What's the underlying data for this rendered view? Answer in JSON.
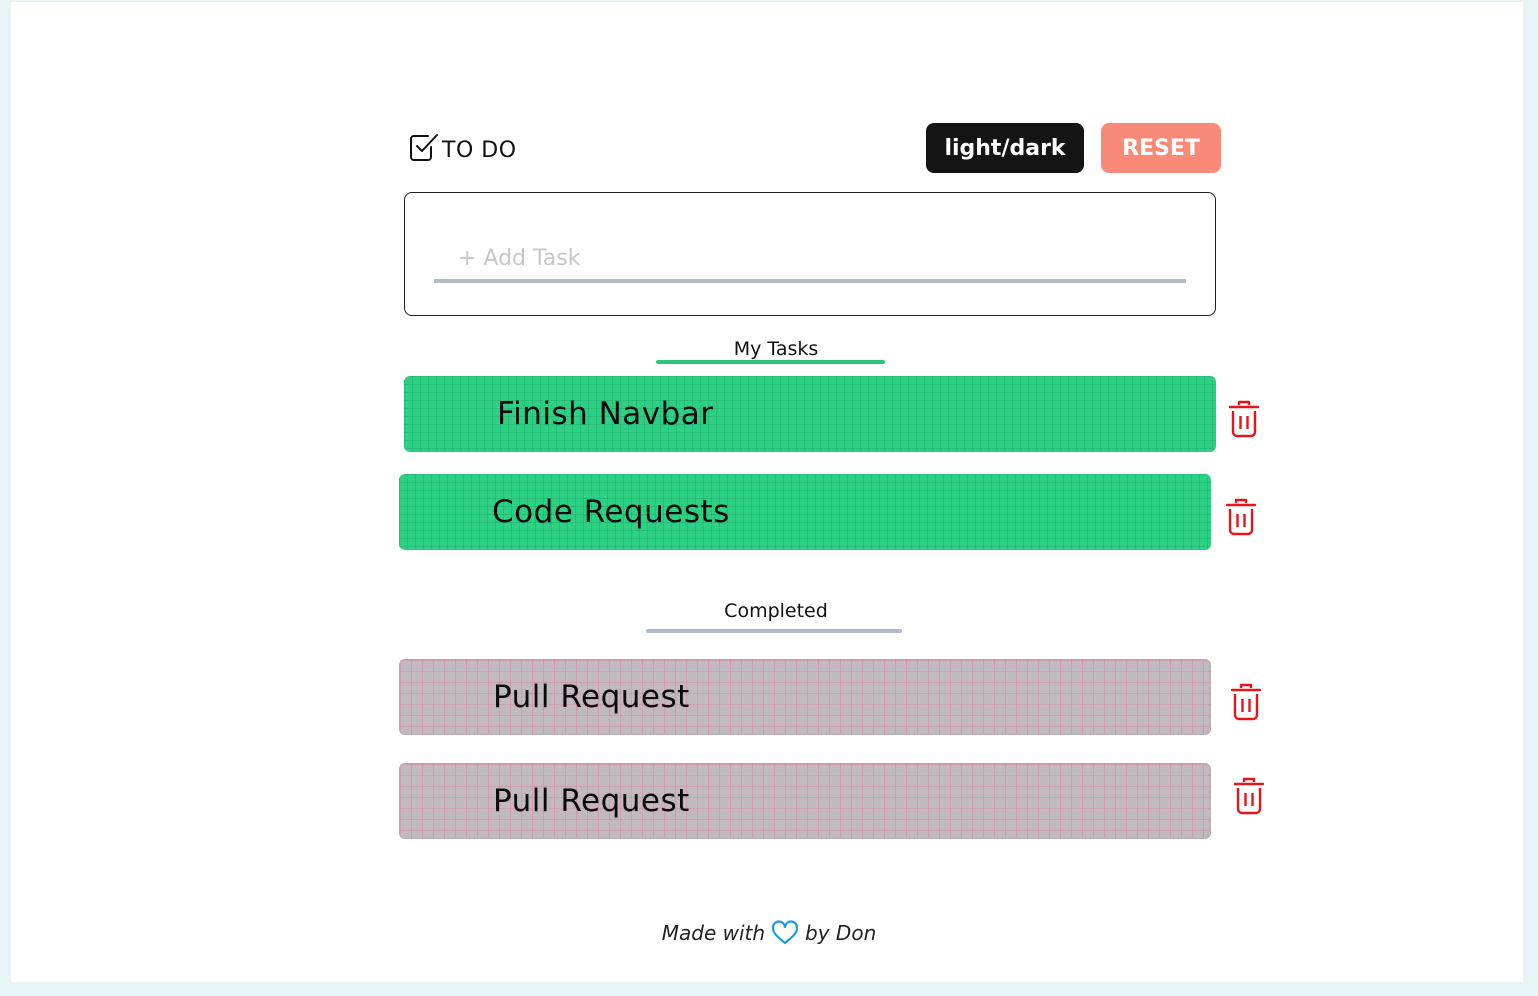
{
  "header": {
    "brand_label": "TO DO",
    "brand_icon": "checkbox-icon",
    "theme_toggle_label": "light/dark",
    "reset_label": "RESET"
  },
  "add_task": {
    "placeholder": "+ Add Task",
    "value": ""
  },
  "sections": {
    "my_tasks_title": "My Tasks",
    "completed_title": "Completed"
  },
  "tasks": [
    {
      "title": "Finish Navbar",
      "status": "active"
    },
    {
      "title": "Code Requests",
      "status": "active"
    }
  ],
  "completed": [
    {
      "title": "Pull Request",
      "status": "completed"
    },
    {
      "title": "Pull Request",
      "status": "completed"
    }
  ],
  "footer": {
    "prefix": "Made with",
    "icon": "heart-icon",
    "suffix": "by Don"
  },
  "colors": {
    "active_task": "#2dd184",
    "completed_task": "#c2b8c0",
    "reset_button": "#fa8a78",
    "theme_button": "#141414",
    "trash_icon": "#e8141c",
    "heart_icon": "#1b9be0",
    "my_tasks_underline": "#2ec37a",
    "completed_underline": "#b3b9c6"
  }
}
